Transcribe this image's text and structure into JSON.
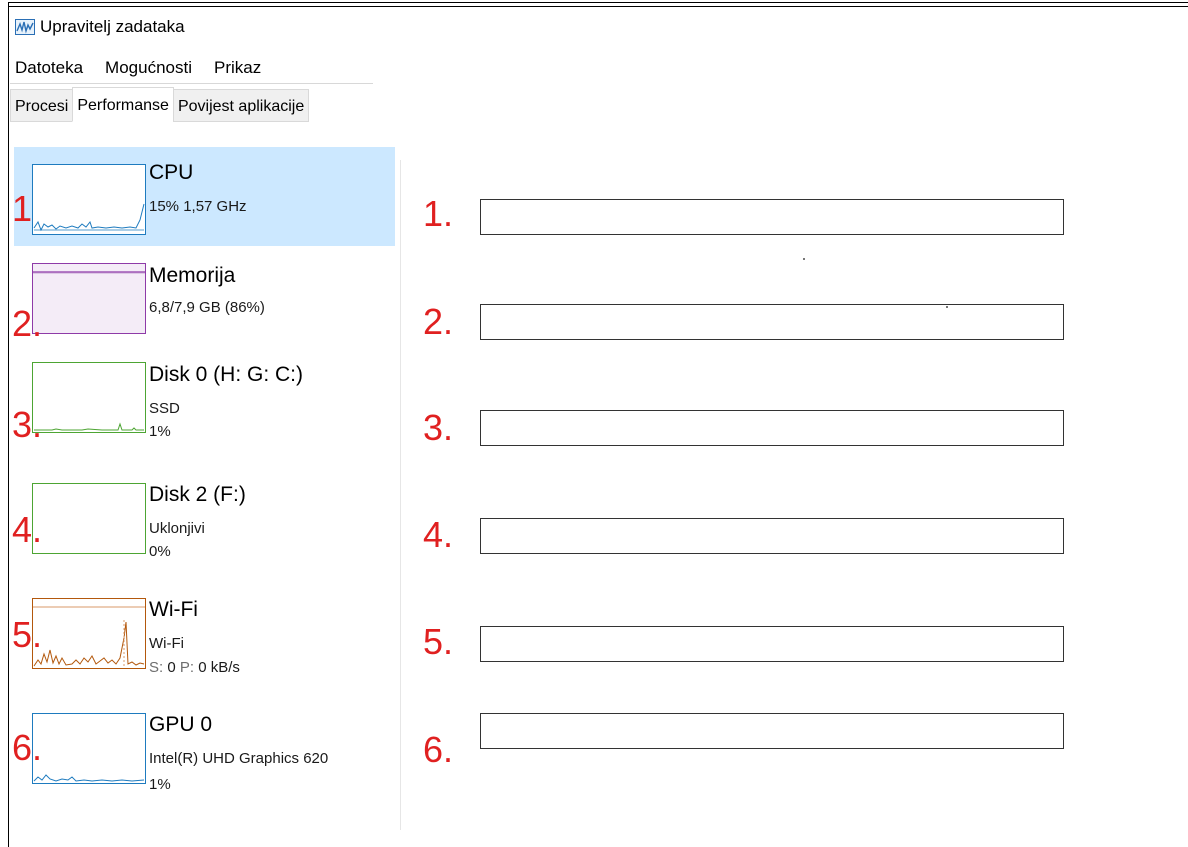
{
  "window": {
    "title": "Upravitelj zadataka",
    "icon": "task-manager-icon"
  },
  "menu": {
    "items": [
      "Datoteka",
      "Mogućnosti",
      "Prikaz"
    ]
  },
  "tabs": [
    {
      "label": "Procesi",
      "active": false
    },
    {
      "label": "Performanse",
      "active": true
    },
    {
      "label": "Povijest aplikacije",
      "active": false
    }
  ],
  "colors": {
    "selected_bg": "#cce8ff",
    "cpu": "#1e7bbf",
    "memory": "#8e3aa8",
    "disk": "#4da533",
    "wifi": "#b3580c",
    "gpu": "#1e7bbf",
    "annotation": "#e02020"
  },
  "performance_items": [
    {
      "number": "1",
      "name": "CPU",
      "line1": "15% 1,57 GHz",
      "line2": "",
      "selected": true
    },
    {
      "number": "2.",
      "name": "Memorija",
      "line1": "6,8/7,9 GB (86%)",
      "line2": "",
      "selected": false
    },
    {
      "number": "3.",
      "name": "Disk 0 (H: G: C:)",
      "line1": "SSD",
      "line2": "1%",
      "selected": false
    },
    {
      "number": "4.",
      "name": "Disk 2 (F:)",
      "line1": "Uklonjivi",
      "line2": "0%",
      "selected": false
    },
    {
      "number": "5.",
      "name": "Wi-Fi",
      "line1": "Wi-Fi",
      "line2_s_label": "S:",
      "line2_s_value": "0",
      "line2_p_label": "P:",
      "line2_p_value": "0 kB/s",
      "selected": false
    },
    {
      "number": "6.",
      "name": "GPU 0",
      "line1": "Intel(R) UHD Graphics 620",
      "line2": "1%",
      "selected": false
    }
  ],
  "answers": [
    {
      "number": "1.",
      "value": ""
    },
    {
      "number": "2.",
      "value": ""
    },
    {
      "number": "3.",
      "value": ""
    },
    {
      "number": "4.",
      "value": ""
    },
    {
      "number": "5.",
      "value": ""
    },
    {
      "number": "6.",
      "value": ""
    }
  ]
}
